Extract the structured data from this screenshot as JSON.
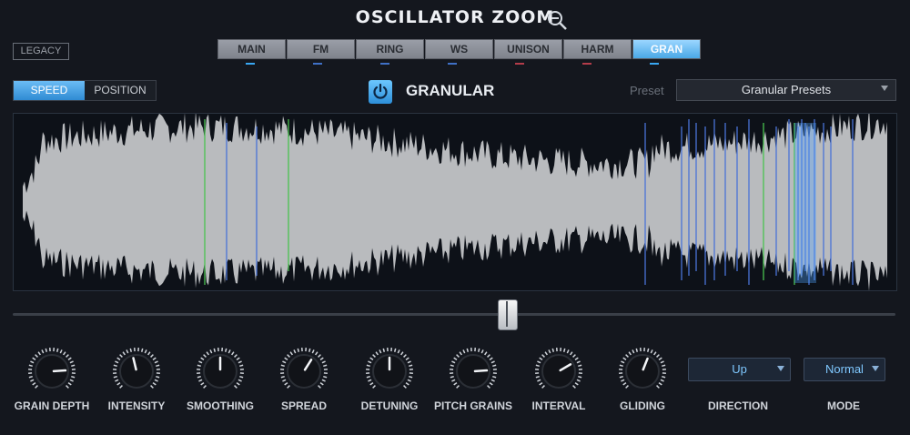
{
  "header": {
    "title": "OSCILLATOR ZOOM",
    "zoom_icon": "zoom-out-icon",
    "legacy_label": "LEGACY"
  },
  "tabs": [
    {
      "label": "MAIN",
      "indicator": "#39a7f2",
      "active": false
    },
    {
      "label": "FM",
      "indicator": "#3f70c6",
      "active": false
    },
    {
      "label": "RING",
      "indicator": "#3f70c6",
      "active": false
    },
    {
      "label": "WS",
      "indicator": "#3f70c6",
      "active": false
    },
    {
      "label": "UNISON",
      "indicator": "#b33c4a",
      "active": false
    },
    {
      "label": "HARM",
      "indicator": "#b33c4a",
      "active": false
    },
    {
      "label": "GRAN",
      "indicator": "#39a7f2",
      "active": true
    }
  ],
  "toggle": {
    "speed": "SPEED",
    "position": "POSITION",
    "active": "speed"
  },
  "granular": {
    "label": "GRANULAR",
    "power_icon": "power-icon"
  },
  "preset": {
    "label": "Preset",
    "value": "Granular Presets"
  },
  "slider": {
    "position": 0.56
  },
  "knobs": [
    {
      "label": "GRAIN DEPTH",
      "value": 0.82
    },
    {
      "label": "INTENSITY",
      "value": 0.45
    },
    {
      "label": "SMOOTHING",
      "value": 0.5
    },
    {
      "label": "SPREAD",
      "value": 0.62
    },
    {
      "label": "DETUNING",
      "value": 0.5
    },
    {
      "label": "PITCH GRAINS",
      "value": 0.82
    },
    {
      "label": "INTERVAL",
      "value": 0.72
    },
    {
      "label": "GLIDING",
      "value": 0.58
    }
  ],
  "dropdowns": {
    "direction": {
      "label": "DIRECTION",
      "value": "Up"
    },
    "mode": {
      "label": "MODE",
      "value": "Normal"
    }
  },
  "colors": {
    "accent": "#39a7f2",
    "waveform": "#b9bbbe",
    "grain_blue": "#4a74d8",
    "grain_green": "#49c24f"
  }
}
